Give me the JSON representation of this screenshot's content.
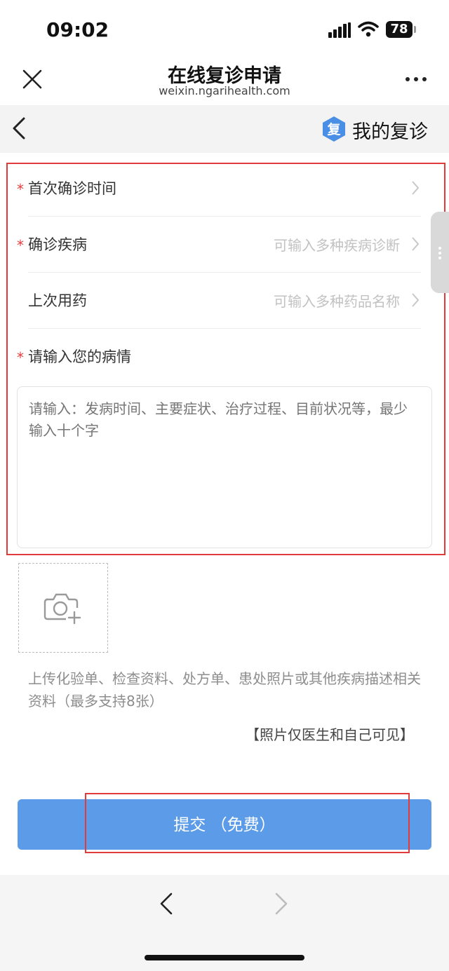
{
  "status_bar": {
    "time": "09:02",
    "battery": "78"
  },
  "nav": {
    "title": "在线复诊申请",
    "subtitle": "weixin.ngarihealth.com"
  },
  "header": {
    "badge_char": "复",
    "my_label": "我的复诊"
  },
  "form": {
    "required_mark": "*",
    "first_diagnosis": {
      "label": "首次确诊时间"
    },
    "diagnosis": {
      "label": "确诊疾病",
      "placeholder": "可输入多种疾病诊断"
    },
    "last_medication": {
      "label": "上次用药",
      "placeholder": "可输入多种药品名称"
    },
    "condition": {
      "label": "请输入您的病情",
      "placeholder": "请输入：发病时间、主要症状、治疗过程、目前状况等，最少输入十个字"
    }
  },
  "upload": {
    "hint": "上传化验单、检查资料、处方单、患处照片或其他疾病描述相关资料（最多支持8张）",
    "privacy_note": "【照片仅医生和自己可见】"
  },
  "submit": {
    "label": "提交 （免费）"
  },
  "colors": {
    "accent": "#5b9be8",
    "required": "#e23b3b",
    "badge": "#4a8fe6"
  }
}
